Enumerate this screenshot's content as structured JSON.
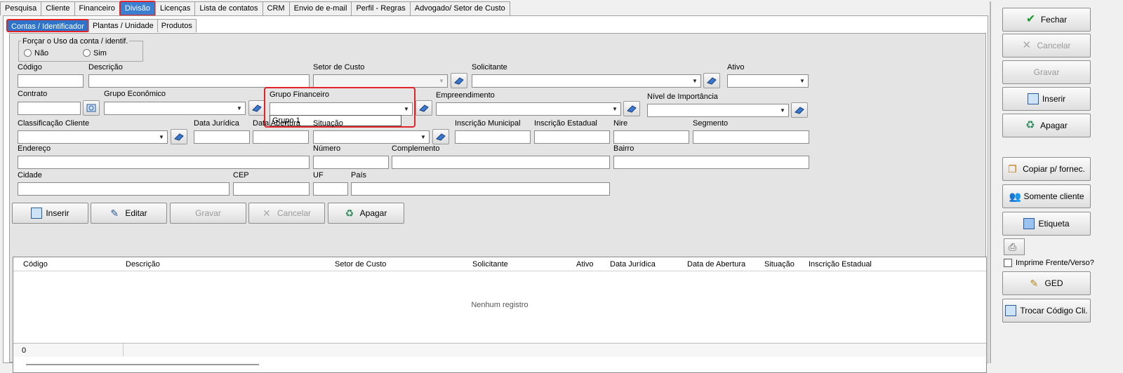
{
  "tabs": [
    "Pesquisa",
    "Cliente",
    "Financeiro",
    "Divisão",
    "Licenças",
    "Lista de contatos",
    "CRM",
    "Envio de e-mail",
    "Perfil - Regras",
    "Advogado/ Setor de Custo"
  ],
  "subtabs": [
    "Contas / Identificador",
    "Plantas / Unidade",
    "Produtos"
  ],
  "force_group": {
    "title": "Forçar o Uso da conta / identif.",
    "opt_no": "Não",
    "opt_yes": "Sim"
  },
  "labels": {
    "codigo": "Código",
    "descricao": "Descrição",
    "setor": "Setor de Custo",
    "solicitante": "Solicitante",
    "ativo": "Ativo",
    "contrato": "Contrato",
    "grupo_eco": "Grupo Econômico",
    "grupo_fin": "Grupo Financeiro",
    "empreendimento": "Empreendimento",
    "nivel": "Nível de Importância",
    "classificacao": "Classificação Cliente",
    "data_juridica": "Data Jurídica",
    "data_ab": "Data Abertura",
    "situacao": "Situação",
    "insc_mun": "Inscrição Municipal",
    "insc_est": "Inscrição Estadual",
    "nire": "Nire",
    "segmento": "Segmento",
    "endereco": "Endereço",
    "numero": "Número",
    "complemento": "Complemento",
    "bairro": "Bairro",
    "cidade": "Cidade",
    "cep": "CEP",
    "uf": "UF",
    "pais": "País"
  },
  "dropdown_option": "Grupo 1",
  "actions": {
    "inserir": "Inserir",
    "editar": "Editar",
    "gravar": "Gravar",
    "cancelar": "Cancelar",
    "apagar": "Apagar"
  },
  "grid": {
    "columns": [
      "Código",
      "Descrição",
      "Setor de Custo",
      "Solicitante",
      "Ativo",
      "Data Jurídica",
      "Data de Abertura",
      "Situação",
      "Inscrição Estadual"
    ],
    "empty": "Nenhum registro",
    "count": "0"
  },
  "right": {
    "fechar": "Fechar",
    "cancelar": "Cancelar",
    "gravar": "Gravar",
    "inserir": "Inserir",
    "apagar": "Apagar",
    "copiar": "Copiar p/ fornec.",
    "somente": "Somente cliente",
    "etiqueta": "Etiqueta",
    "imprime": "Imprime Frente/Verso?",
    "ged": "GED",
    "trocar": "Trocar Código Cli."
  }
}
